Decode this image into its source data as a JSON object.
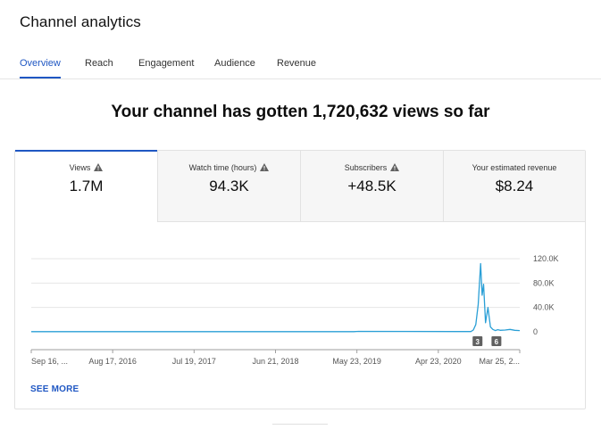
{
  "page": {
    "title": "Channel analytics"
  },
  "tabs": [
    {
      "label": "Overview",
      "active": true
    },
    {
      "label": "Reach",
      "active": false
    },
    {
      "label": "Engagement",
      "active": false
    },
    {
      "label": "Audience",
      "active": false
    },
    {
      "label": "Revenue",
      "active": false
    }
  ],
  "headline": "Your channel has gotten 1,720,632 views so far",
  "metrics": [
    {
      "label": "Views",
      "value": "1.7M",
      "warning": true,
      "active": true
    },
    {
      "label": "Watch time (hours)",
      "value": "94.3K",
      "warning": true,
      "active": false
    },
    {
      "label": "Subscribers",
      "value": "+48.5K",
      "warning": true,
      "active": false
    },
    {
      "label": "Your estimated revenue",
      "value": "$8.24",
      "warning": false,
      "active": false
    }
  ],
  "colors": {
    "accent": "#1f57c3",
    "line": "#2a9fd6",
    "warning": "#606060"
  },
  "chart_data": {
    "type": "line",
    "series_label": "Views",
    "ylim": [
      0,
      120000
    ],
    "y_ticks": [
      0,
      40000,
      80000,
      120000
    ],
    "y_tick_labels": [
      "0",
      "40.0K",
      "80.0K",
      "120.0K"
    ],
    "x_tick_labels": [
      "Sep 16, ...",
      "Aug 17, 2016",
      "Jul 19, 2017",
      "Jun 21, 2018",
      "May 23, 2019",
      "Apr 23, 2020",
      "Mar 25, 2..."
    ],
    "grid": true,
    "annotations": [
      "3",
      "6"
    ],
    "x": [
      0,
      0.66,
      0.67,
      0.88,
      0.89,
      0.9,
      0.905,
      0.91,
      0.915,
      0.92,
      0.923,
      0.926,
      0.93,
      0.935,
      0.94,
      0.945,
      0.95,
      0.955,
      0.96,
      0.97,
      0.98,
      0.99,
      1
    ],
    "values": [
      300,
      300,
      800,
      400,
      600,
      500,
      3000,
      12000,
      45000,
      112000,
      60000,
      78000,
      15000,
      40000,
      8000,
      4000,
      2000,
      3500,
      2500,
      3000,
      4000,
      2500,
      2000
    ]
  },
  "see_more": "SEE MORE"
}
